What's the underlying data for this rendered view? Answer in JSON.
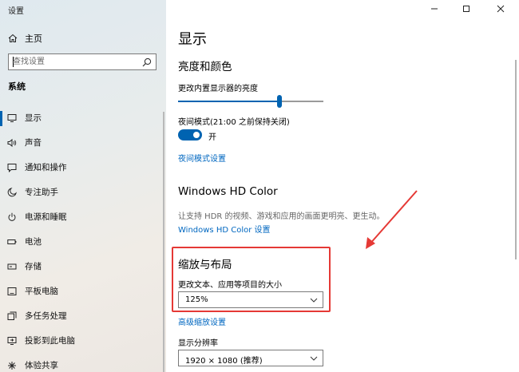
{
  "app": {
    "title": "设置"
  },
  "sidebar": {
    "home_label": "主页",
    "search_placeholder": "查找设置",
    "section_title": "系统",
    "items": [
      {
        "label": "显示",
        "icon": "monitor-icon"
      },
      {
        "label": "声音",
        "icon": "speaker-icon"
      },
      {
        "label": "通知和操作",
        "icon": "notification-icon"
      },
      {
        "label": "专注助手",
        "icon": "moon-icon"
      },
      {
        "label": "电源和睡眠",
        "icon": "power-icon"
      },
      {
        "label": "电池",
        "icon": "battery-icon"
      },
      {
        "label": "存储",
        "icon": "storage-icon"
      },
      {
        "label": "平板电脑",
        "icon": "tablet-icon"
      },
      {
        "label": "多任务处理",
        "icon": "multitask-icon"
      },
      {
        "label": "投影到此电脑",
        "icon": "project-icon"
      },
      {
        "label": "体验共享",
        "icon": "share-icon"
      }
    ],
    "active_index": 0
  },
  "main": {
    "page_title": "显示",
    "brightness": {
      "heading": "亮度和颜色",
      "slider_label": "更改内置显示器的亮度",
      "level": 0.7
    },
    "night_light": {
      "label": "夜间模式(21:00 之前保持关闭)",
      "state": "开",
      "settings_link": "夜间模式设置"
    },
    "hdr": {
      "heading": "Windows HD Color",
      "description": "让支持 HDR 的视频、游戏和应用的画面更明亮、更生动。",
      "settings_link": "Windows HD Color 设置"
    },
    "scale": {
      "heading": "缩放与布局",
      "label": "更改文本、应用等项目的大小",
      "value": "125%",
      "advanced_link": "高级缩放设置"
    },
    "resolution": {
      "label": "显示分辨率",
      "value": "1920 × 1080 (推荐)"
    }
  },
  "colors": {
    "accent": "#0063b1",
    "link": "#0067c0",
    "highlight": "#e53935"
  }
}
